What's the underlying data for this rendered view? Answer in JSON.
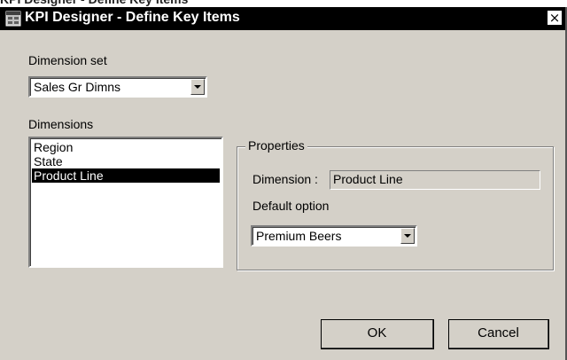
{
  "window": {
    "title": "KPI Designer - Define Key Items",
    "close_glyph": "×"
  },
  "dimension_set": {
    "label": "Dimension set",
    "selected": "Sales Gr Dimns"
  },
  "dimensions": {
    "label": "Dimensions",
    "items": [
      "Region",
      "State",
      "Product Line"
    ],
    "selected_index": 2
  },
  "properties": {
    "legend": "Properties",
    "dimension_label": "Dimension :",
    "dimension_value": "Product Line",
    "default_option_label": "Default option",
    "default_option_selected": "Premium Beers"
  },
  "buttons": {
    "ok": "OK",
    "cancel": "Cancel"
  },
  "icons": {
    "app": "grid-window-icon",
    "close": "close-icon",
    "dropdown": "chevron-down-icon"
  },
  "colors": {
    "titlebar": "#000000",
    "dialog_bg": "#d4d0c8",
    "selection": "#000000"
  }
}
